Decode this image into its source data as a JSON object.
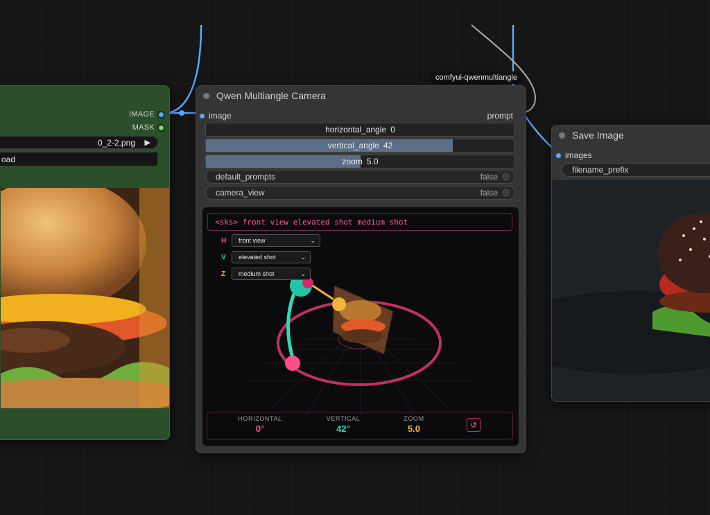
{
  "load_node": {
    "outputs": [
      "IMAGE",
      "MASK"
    ],
    "filename": "0_2-2.png",
    "upload_label": "oad"
  },
  "reroute_label": "comfyui-qwenmultiangle",
  "qwen_node": {
    "title": "Qwen Multiangle Camera",
    "input_label": "image",
    "output_label": "prompt",
    "sliders": [
      {
        "name": "horizontal_angle",
        "value": "0",
        "level": 0.0
      },
      {
        "name": "vertical_angle",
        "value": "42",
        "level": 0.8
      },
      {
        "name": "zoom",
        "value": "5.0",
        "level": 0.5
      }
    ],
    "toggles": [
      {
        "name": "default_prompts",
        "value": "false"
      },
      {
        "name": "camera_view",
        "value": "false"
      }
    ],
    "viewport": {
      "prompt_text": "<sks> front view elevated shot medium shot",
      "selects": [
        {
          "key": "H",
          "value": "front view",
          "color": "#ff4f8b"
        },
        {
          "key": "V",
          "value": "elevated shot",
          "color": "#2fd8b8"
        },
        {
          "key": "Z",
          "value": "medium shot",
          "color": "#f0b43a"
        }
      ],
      "stats": [
        {
          "label": "HORIZONTAL",
          "value": "0°",
          "color": "#ff4f8b"
        },
        {
          "label": "VERTICAL",
          "value": "42°",
          "color": "#2fd8b8"
        },
        {
          "label": "ZOOM",
          "value": "5.0",
          "color": "#f0b43a"
        }
      ],
      "reset_icon": "↺"
    }
  },
  "save_node": {
    "title": "Save Image",
    "input_label": "images",
    "filename_prefix_label": "filename_prefix"
  },
  "colors": {
    "wire_image": "#5aa8ff",
    "wire_prompt": "#a8b0a8",
    "accent_pink": "#ff4f8b",
    "accent_teal": "#2fd8b8",
    "accent_gold": "#f0b43a"
  }
}
